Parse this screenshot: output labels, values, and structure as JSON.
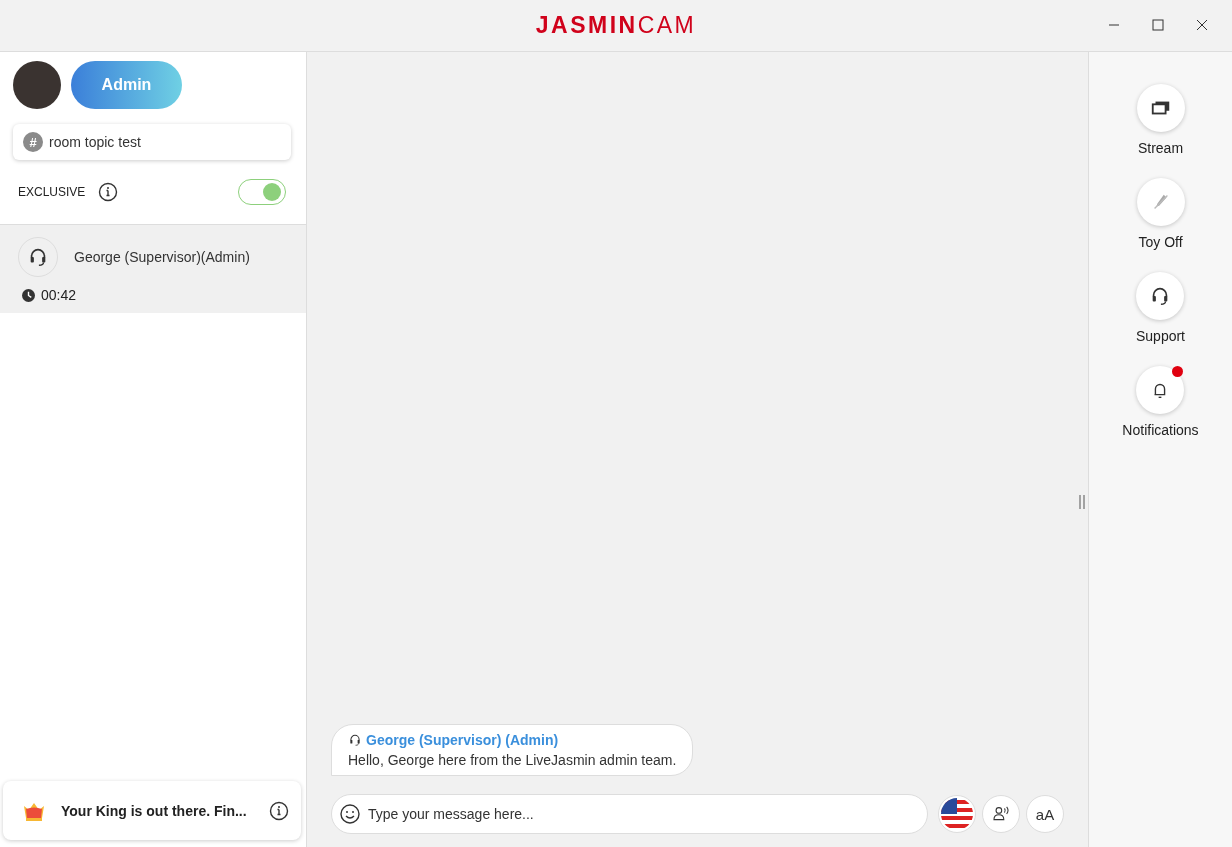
{
  "window": {
    "logo_bold": "JASMIN",
    "logo_light": "CAM"
  },
  "sidebar": {
    "role_button": "Admin",
    "room_topic": {
      "icon": "#",
      "value": "room topic test"
    },
    "exclusive": {
      "label": "EXCLUSIVE",
      "on": true
    },
    "sessions": [
      {
        "name": "George (Supervisor)(Admin)",
        "time": "00:42",
        "selected": true
      }
    ],
    "promo": {
      "text": "Your King is out there. Fin..."
    }
  },
  "chat": {
    "messages": [
      {
        "author": "George (Supervisor) (Admin)",
        "text": "Hello, George here from the LiveJasmin admin team."
      }
    ],
    "input": {
      "placeholder": "Type your message here..."
    },
    "font_button": "aA"
  },
  "actions": [
    {
      "kind": "stream",
      "label": "Stream",
      "alert": false
    },
    {
      "kind": "toy",
      "label": "Toy Off",
      "alert": false
    },
    {
      "kind": "support",
      "label": "Support",
      "alert": false
    },
    {
      "kind": "notifications",
      "label": "Notifications",
      "alert": true
    }
  ]
}
